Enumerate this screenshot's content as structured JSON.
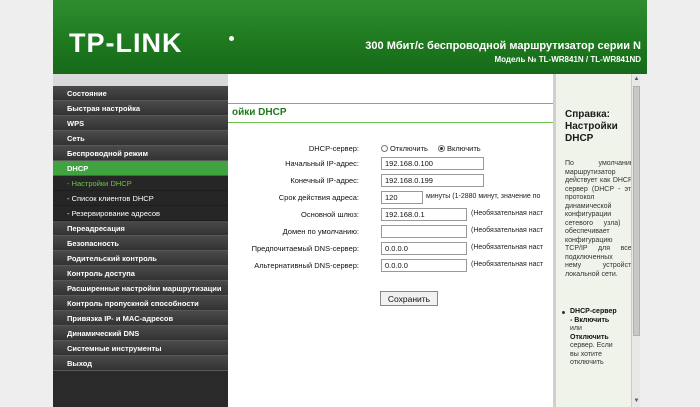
{
  "header": {
    "logo": "TP-LINK",
    "title": "300 Мбит/с беспроводной маршрутизатор серии N",
    "model": "Модель № TL-WR841N / TL-WR841ND",
    "color": "#1f7a1f"
  },
  "sidebar": {
    "items": [
      {
        "label": "Состояние"
      },
      {
        "label": "Быстрая настройка"
      },
      {
        "label": "WPS"
      },
      {
        "label": "Сеть"
      },
      {
        "label": "Беспроводной режим"
      },
      {
        "label": "DHCP"
      },
      {
        "label": "- Настройки DHCP"
      },
      {
        "label": "- Список клиентов DHCP"
      },
      {
        "label": "- Резервирование адресов"
      },
      {
        "label": "Переадресация"
      },
      {
        "label": "Безопасность"
      },
      {
        "label": "Родительский контроль"
      },
      {
        "label": "Контроль доступа"
      },
      {
        "label": "Расширенные настройки маршрутизации"
      },
      {
        "label": "Контроль пропускной способности"
      },
      {
        "label": "Привязка IP- и MAC-адресов"
      },
      {
        "label": "Динамический DNS"
      },
      {
        "label": "Системные инструменты"
      },
      {
        "label": "Выход"
      }
    ],
    "active_color": "#3fa43f"
  },
  "main": {
    "title": "ойки DHCP",
    "dhcp_server": {
      "label": "DHCP-сервер:",
      "options": [
        "Отключить",
        "Включить"
      ],
      "selected": "Включить"
    },
    "fields": {
      "start_ip": {
        "label": "Начальный IP-адрес:",
        "value": "192.168.0.100"
      },
      "end_ip": {
        "label": "Конечный IP-адрес:",
        "value": "192.168.0.199"
      },
      "lease": {
        "label": "Срок действия адреса:",
        "value": "120",
        "note": "минуты (1-2880 минут, значение по"
      },
      "gateway": {
        "label": "Основной шлюз:",
        "value": "192.168.0.1",
        "note": "(Необязательная наст"
      },
      "domain": {
        "label": "Домен по умолчанию:",
        "value": "",
        "note": "(Необязательная наст"
      },
      "dns_primary": {
        "label": "Предпочитаемый DNS-сервер:",
        "value": "0.0.0.0",
        "note": "(Необязательная наст"
      },
      "dns_secondary": {
        "label": "Альтернативный DNS-сервер:",
        "value": "0.0.0.0",
        "note": "(Необязательная наст"
      }
    },
    "save_label": "Сохранить"
  },
  "help": {
    "title": "Справка: Настройки DHCP",
    "body": "По умолчанию маршрутизатор действует как DHCP-сервер (DHCP - это протокол динамической конфигурации сетевого узла) и обеспечивает конфигурацию TCP/IP для всех подключенных к нему устройств локальной сети.",
    "bullet_term": "DHCP-сервер - Включить",
    "bullet_or": "или",
    "bullet_term2": "Отключить",
    "bullet_rest": "сервер. Если вы хотите отключить"
  }
}
